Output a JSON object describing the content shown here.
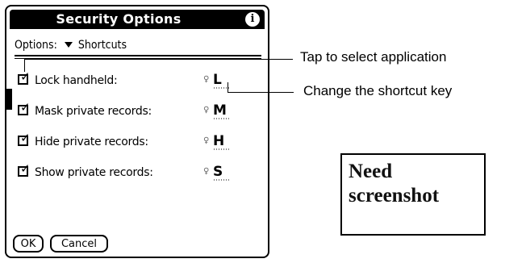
{
  "dialog": {
    "title": "Security Options",
    "options_menu": "Options:",
    "options_value": "Shortcuts",
    "items": [
      {
        "label": "Lock handheld:",
        "checked": true,
        "key": "L"
      },
      {
        "label": "Mask private records:",
        "checked": true,
        "key": "M"
      },
      {
        "label": "Hide private records:",
        "checked": true,
        "key": "H"
      },
      {
        "label": "Show private records:",
        "checked": true,
        "key": "S"
      }
    ],
    "buttons": {
      "ok": "OK",
      "cancel": "Cancel"
    }
  },
  "callouts": {
    "select_app": "Tap to select application",
    "change_key": "Change the shortcut key"
  },
  "placeholder": {
    "line1": "Need",
    "line2": "screenshot"
  }
}
